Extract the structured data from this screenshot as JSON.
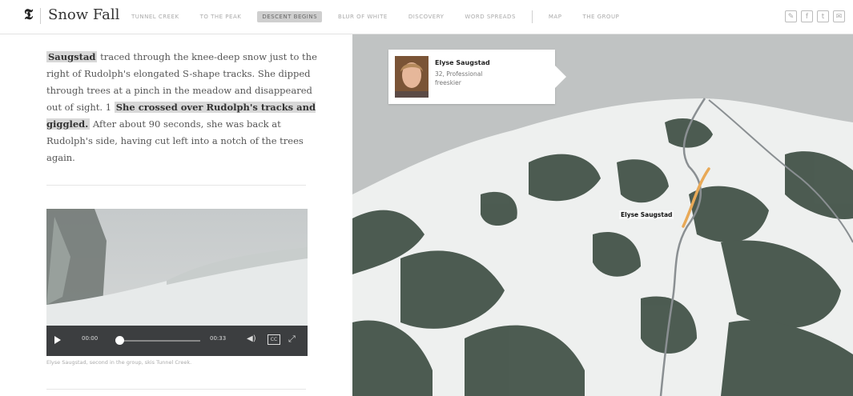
{
  "brand": {
    "title": "Snow Fall"
  },
  "nav": {
    "links": [
      {
        "label": "TUNNEL CREEK",
        "active": false
      },
      {
        "label": "TO THE PEAK",
        "active": false
      },
      {
        "label": "DESCENT BEGINS",
        "active": true
      },
      {
        "label": "BLUR OF WHITE",
        "active": false
      },
      {
        "label": "DISCOVERY",
        "active": false
      },
      {
        "label": "WORD SPREADS",
        "active": false
      }
    ],
    "secondary": [
      {
        "label": "MAP"
      },
      {
        "label": "THE GROUP"
      }
    ],
    "social_icons": [
      "comment-icon",
      "facebook-icon",
      "twitter-icon",
      "email-icon"
    ]
  },
  "story": {
    "name_lead": "Saugstad",
    "text_1": " traced through the knee-deep snow just to the right of Rudolph's elongated S-shape tracks. She dipped through trees at a pinch in the meadow and disappeared out of sight. ",
    "marker": "1",
    "bold_1": "She crossed over Rudolph's tracks and giggled.",
    "text_2": " After about 90 seconds, she was back at Rudolph's side, having cut left into a notch of the trees again."
  },
  "video": {
    "time_current": "00:00",
    "time_total": "00:33",
    "progress": 0,
    "cc_label": "CC",
    "caption": "Elyse Saugstad, second in the group, skis Tunnel Creek."
  },
  "map": {
    "callout": {
      "name": "Elyse Saugstad",
      "role": "32, Professional freeskier"
    },
    "route_label": "Elyse Saugstad",
    "colors": {
      "route": "#e8a957",
      "path": "#8a8f92",
      "snow": "#eef0ef",
      "trees": "#3b4b40"
    }
  }
}
